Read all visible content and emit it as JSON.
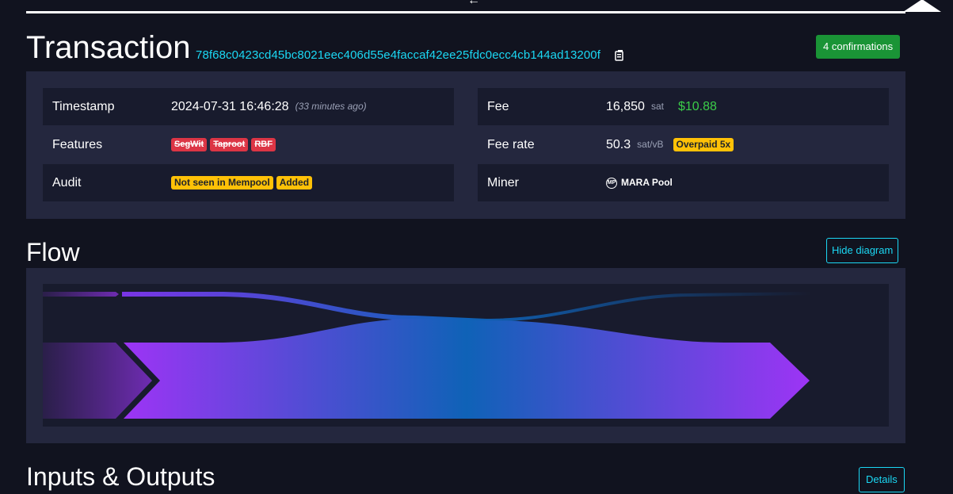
{
  "header": {
    "back_icon": "←",
    "title": "Transaction",
    "txid": "78f68c0423cd45bc8021eec406d55e4faccaf42ee25fdc0ecc4cb144ad13200f",
    "confirmations": "4 confirmations"
  },
  "details": {
    "timestamp": {
      "label": "Timestamp",
      "value": "2024-07-31 16:46:28",
      "relative": "(33 minutes ago)"
    },
    "features": {
      "label": "Features",
      "badges": [
        "SegWit",
        "Taproot",
        "RBF"
      ]
    },
    "audit": {
      "label": "Audit",
      "badges": [
        "Not seen in Mempool",
        "Added"
      ]
    },
    "fee": {
      "label": "Fee",
      "value": "16,850",
      "unit": "sat",
      "usd": "$10.88"
    },
    "fee_rate": {
      "label": "Fee rate",
      "value": "50.3",
      "unit": "sat/vB",
      "badge": "Overpaid 5x"
    },
    "miner": {
      "label": "Miner",
      "logo": "MP",
      "name": "MARA Pool"
    }
  },
  "flow": {
    "title": "Flow",
    "hide_button": "Hide diagram"
  },
  "io": {
    "title": "Inputs & Outputs",
    "details_button": "Details"
  },
  "colors": {
    "accent": "#1bd8f4",
    "confirm_green": "#1a9436",
    "flow_purple": "#9333ea",
    "flow_blue": "#0f62b7"
  }
}
